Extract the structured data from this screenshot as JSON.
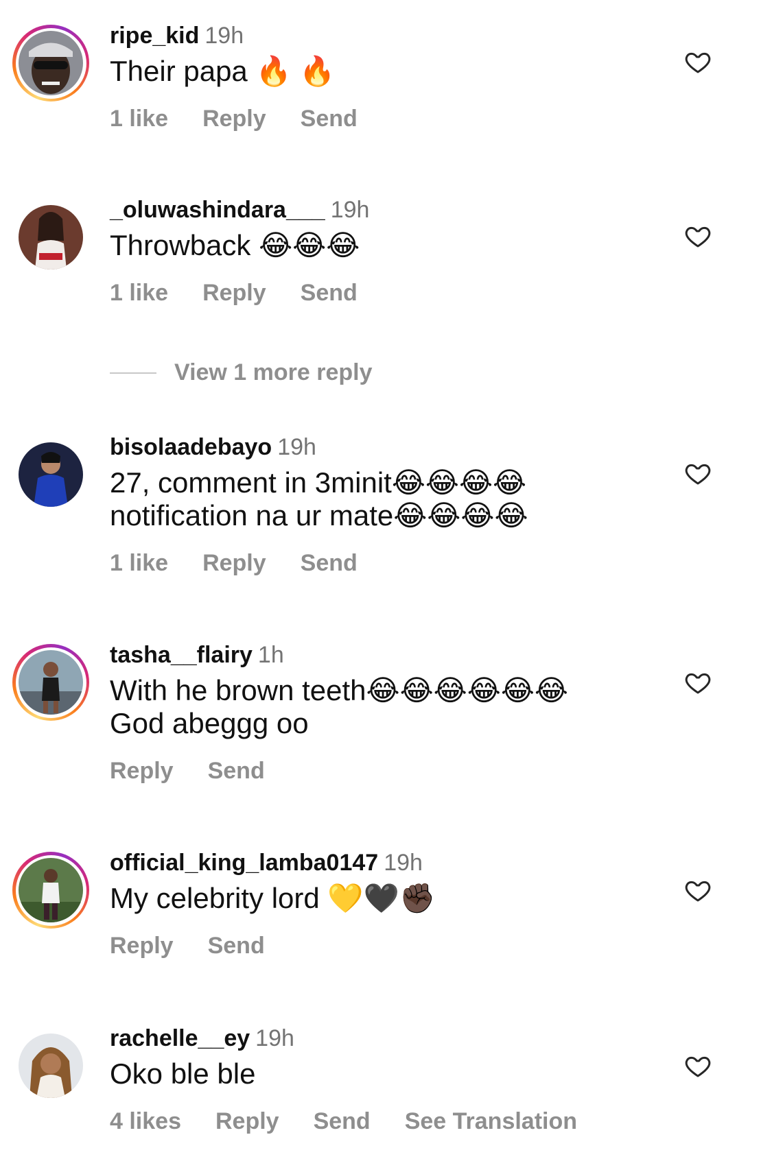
{
  "colors": {
    "text": "#111111",
    "muted": "#8e8e8e",
    "time": "#737373"
  },
  "comments": [
    {
      "username": "ripe_kid",
      "time": "19h",
      "text": "Their papa 🔥 🔥",
      "likes": "1 like",
      "reply": "Reply",
      "send": "Send",
      "story_ring": true
    },
    {
      "username": "_oluwashindara___",
      "time": "19h",
      "text": "Throwback 😂😂😂",
      "likes": "1 like",
      "reply": "Reply",
      "send": "Send",
      "story_ring": false
    },
    {
      "username": "bisolaadebayo",
      "time": "19h",
      "text_line1": "27, comment in 3minit😂😂😂😂",
      "text_line2": "notification na ur mate😂😂😂😂",
      "likes": "1 like",
      "reply": "Reply",
      "send": "Send",
      "story_ring": false
    },
    {
      "username": "tasha__flairy",
      "time": "1h",
      "text_line1": "With he brown teeth😂😂😂😂😂😂",
      "text_line2": "God abeggg oo",
      "reply": "Reply",
      "send": "Send",
      "story_ring": true
    },
    {
      "username": "official_king_lamba0147",
      "time": "19h",
      "text": "My celebrity lord 💛🖤✊🏿",
      "reply": "Reply",
      "send": "Send",
      "story_ring": true
    },
    {
      "username": "rachelle__ey",
      "time": "19h",
      "text": "Oko ble ble",
      "likes": "4 likes",
      "reply": "Reply",
      "send": "Send",
      "see_translation": "See Translation",
      "story_ring": false
    }
  ],
  "view_more_reply": "View 1 more reply",
  "icons": {
    "like": "heart-outline-icon"
  }
}
